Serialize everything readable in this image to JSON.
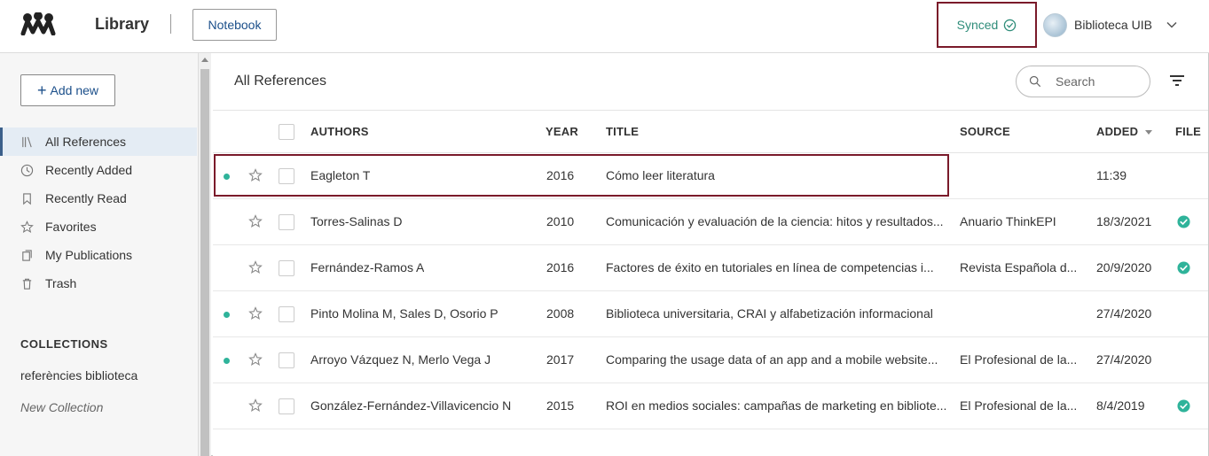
{
  "header": {
    "app_title": "Library",
    "notebook_label": "Notebook",
    "sync_status": "Synced",
    "account_name": "Biblioteca UIB"
  },
  "sidebar": {
    "add_new_label": "Add new",
    "nav_items": [
      {
        "label": "All References",
        "icon": "library-icon",
        "active": true
      },
      {
        "label": "Recently Added",
        "icon": "clock-icon"
      },
      {
        "label": "Recently Read",
        "icon": "bookmark-icon"
      },
      {
        "label": "Favorites",
        "icon": "star-icon"
      },
      {
        "label": "My Publications",
        "icon": "publications-icon"
      },
      {
        "label": "Trash",
        "icon": "trash-icon"
      }
    ],
    "collections_heading": "COLLECTIONS",
    "collections": [
      "referències biblioteca"
    ],
    "new_collection_label": "New Collection"
  },
  "main": {
    "title": "All References",
    "search_placeholder": "Search",
    "columns": {
      "authors": "AUTHORS",
      "year": "YEAR",
      "title": "TITLE",
      "source": "SOURCE",
      "added": "ADDED",
      "file": "FILE"
    },
    "rows": [
      {
        "unread": true,
        "authors": "Eagleton T",
        "year": "2016",
        "title": "Cómo leer literatura",
        "source": "",
        "added": "11:39",
        "has_file": false
      },
      {
        "unread": false,
        "authors": "Torres-Salinas D",
        "year": "2010",
        "title": "Comunicación y evaluación de la ciencia: hitos y resultados...",
        "source": "Anuario ThinkEPI",
        "added": "18/3/2021",
        "has_file": true
      },
      {
        "unread": false,
        "authors": "Fernández-Ramos A",
        "year": "2016",
        "title": "Factores de éxito en tutoriales en línea de competencias i...",
        "source": "Revista Española d...",
        "added": "20/9/2020",
        "has_file": true
      },
      {
        "unread": true,
        "authors": "Pinto Molina M, Sales D, Osorio P",
        "year": "2008",
        "title": "Biblioteca universitaria, CRAI y alfabetización informacional",
        "source": "",
        "added": "27/4/2020",
        "has_file": false
      },
      {
        "unread": true,
        "authors": "Arroyo Vázquez N, Merlo Vega J",
        "year": "2017",
        "title": "Comparing the usage data of an app and a mobile website...",
        "source": "El Profesional de la...",
        "added": "27/4/2020",
        "has_file": false
      },
      {
        "unread": false,
        "authors": "González-Fernández-Villavicencio N",
        "year": "2015",
        "title": "ROI en medios sociales: campañas de marketing en bibliote...",
        "source": "El Profesional de la...",
        "added": "8/4/2019",
        "has_file": true
      }
    ]
  },
  "colors": {
    "accent_blue": "#1b4f8a",
    "sync_green": "#2f8d7a",
    "unread_dot": "#2fb39a",
    "highlight_border": "#7a1a2a"
  }
}
